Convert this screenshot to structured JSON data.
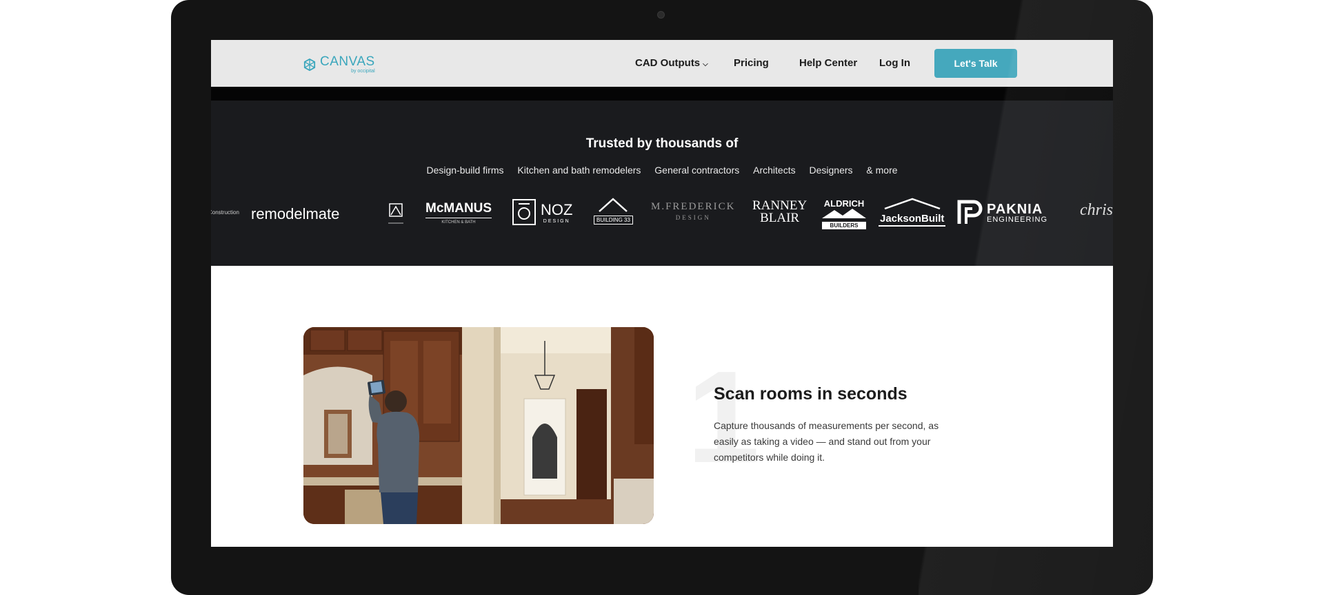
{
  "nav": {
    "logo_text": "CANVAS",
    "logo_sub": "by occipital",
    "links": [
      {
        "label": "CAD Outputs",
        "has_dropdown": true
      },
      {
        "label": "Pricing"
      },
      {
        "label": "Help Center"
      },
      {
        "label": "Log In"
      }
    ],
    "cta_label": "Let's Talk",
    "brand_color": "#45a8bd"
  },
  "trusted": {
    "title": "Trusted by thousands of",
    "segments": [
      "Design-build firms",
      "Kitchen and bath remodelers",
      "General contractors",
      "Architects",
      "Designers",
      "& more"
    ],
    "logos": {
      "partial_left": "Construction",
      "remodelmate": "remodelmate",
      "mcmanus": "McMANUS",
      "mcmanus_sub": "KITCHEN & BATH",
      "noz": "NOZ",
      "noz_sub": "DESIGN",
      "building": "BUILDING 33",
      "mfrederick": "M.FREDERICK",
      "mfrederick_sub": "DESIGN",
      "ranney_1": "RANNEY",
      "ranney_2": "BLAIR",
      "aldrich_1": "ALDRICH",
      "aldrich_2": "BUILDERS",
      "jackson": "JacksonBuilt",
      "paknia": "PAKNIA",
      "paknia_sub": "ENGINEERING",
      "partial_right": "christ"
    }
  },
  "feature": {
    "number": "1",
    "title": "Scan rooms in seconds",
    "description": "Capture thousands of measurements per second, as easily as taking a video — and stand out from your competitors while doing it."
  }
}
